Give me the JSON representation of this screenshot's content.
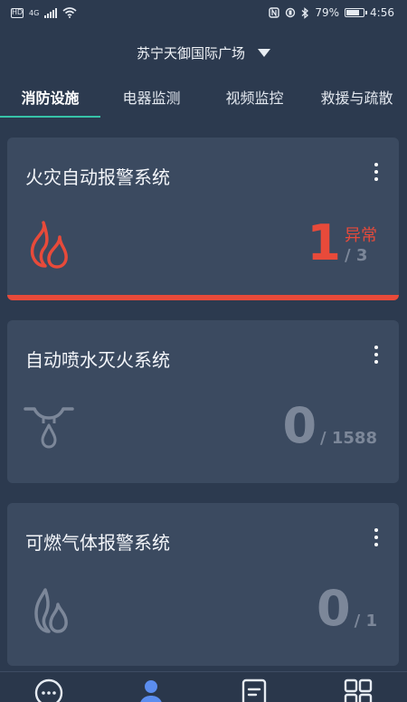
{
  "status_bar": {
    "left_box": "HD",
    "network": "4G",
    "battery_percent": "79%",
    "time": "4:56"
  },
  "location": {
    "name": "苏宁天御国际广场"
  },
  "tabs": [
    {
      "label": "消防设施",
      "active": true
    },
    {
      "label": "电器监测",
      "active": false
    },
    {
      "label": "视频监控",
      "active": false
    },
    {
      "label": "救援与疏散",
      "active": false
    }
  ],
  "cards": [
    {
      "title": "火灾自动报警系统",
      "count": "1",
      "abnormal_label": "异常",
      "total": "/ 3",
      "icon": "flame-icon",
      "status_color": "#e84a3a"
    },
    {
      "title": "自动喷水灭火系统",
      "count": "0",
      "abnormal_label": "",
      "total": "/ 1588",
      "icon": "sprinkler-icon",
      "status_color": "#7c8799"
    },
    {
      "title": "可燃气体报警系统",
      "count": "0",
      "abnormal_label": "",
      "total": "/ 1",
      "icon": "gas-flame-icon",
      "status_color": "#7c8799"
    }
  ],
  "bottom_nav": [
    {
      "icon": "chat-icon"
    },
    {
      "icon": "user-icon",
      "active": true
    },
    {
      "icon": "document-icon"
    },
    {
      "icon": "grid-icon"
    }
  ],
  "colors": {
    "background": "#2c3a4f",
    "card": "#3b4a60",
    "accent": "#36c3a8",
    "alarm": "#e84a3a",
    "muted": "#7c8799",
    "nav_active": "#5b8def"
  }
}
